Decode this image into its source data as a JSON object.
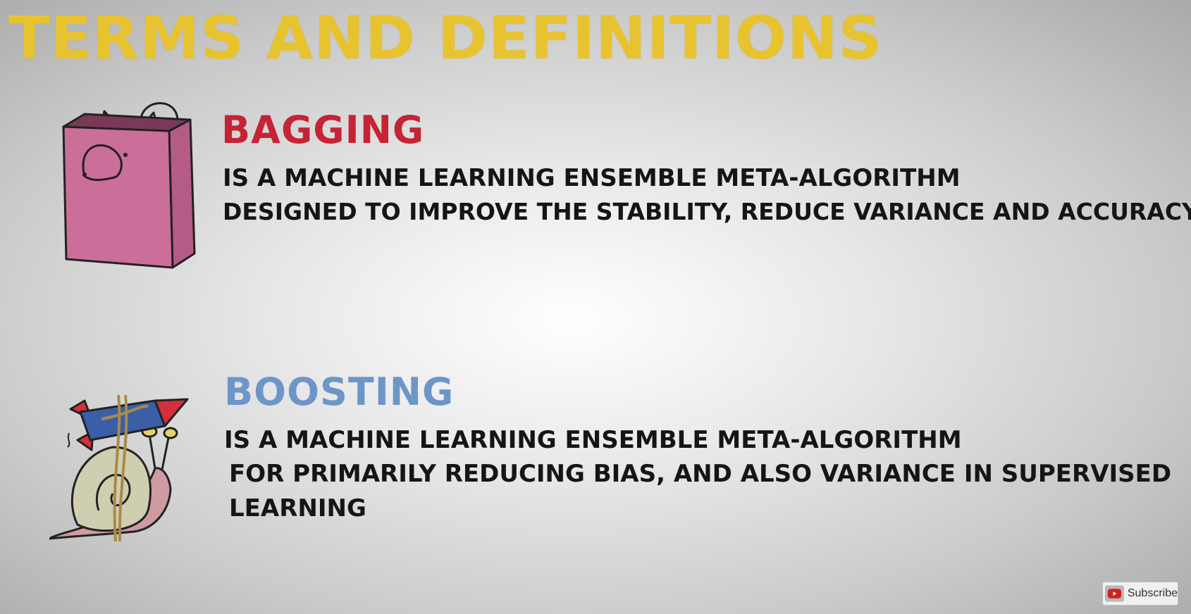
{
  "slide": {
    "title": "TERMS AND DEFINITIONS",
    "colors": {
      "title": "#e7c330",
      "bagging": "#c62335",
      "boosting": "#6d95c8",
      "body_text": "#151515"
    }
  },
  "bagging": {
    "term": "BAGGING",
    "definition_lines": [
      "IS A MACHINE LEARNING ENSEMBLE META-ALGORITHM",
      "DESIGNED TO IMPROVE THE STABILITY, REDUCE VARIANCE AND ACCURACY."
    ],
    "illustration": "cat-in-shopping-bag"
  },
  "boosting": {
    "term": "BOOSTING",
    "definition_lines": [
      "IS A MACHINE LEARNING ENSEMBLE META-ALGORITHM",
      "FOR PRIMARILY REDUCING BIAS, AND ALSO VARIANCE IN SUPERVISED",
      "LEARNING"
    ],
    "illustration": "snail-tied-to-rocket"
  },
  "subscribe_button": {
    "label": "Subscribe",
    "icon": "youtube-icon"
  }
}
